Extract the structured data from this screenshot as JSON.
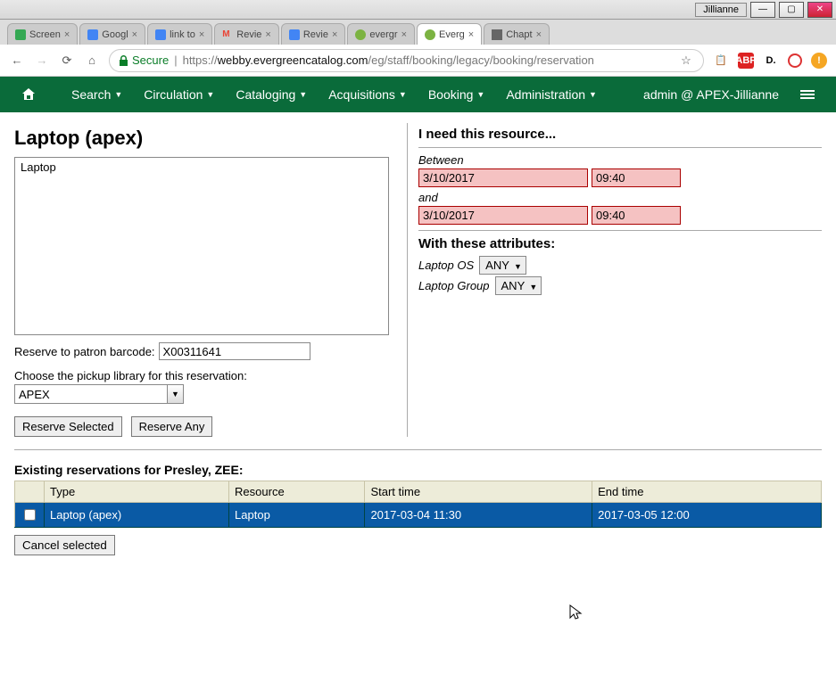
{
  "window": {
    "user": "Jillianne"
  },
  "tabs": [
    {
      "label": "Screen",
      "icon_color": "#34a853"
    },
    {
      "label": "Googl",
      "icon_color": "#4285f4"
    },
    {
      "label": "link to",
      "icon_color": "#4285f4"
    },
    {
      "label": "Revie",
      "icon_color": "#ea4335"
    },
    {
      "label": "Revie",
      "icon_color": "#4285f4"
    },
    {
      "label": "evergr",
      "icon_color": "#7cb342"
    },
    {
      "label": "Everg",
      "icon_color": "#7cb342",
      "active": true
    },
    {
      "label": "Chapt",
      "icon_color": "#555"
    }
  ],
  "addressbar": {
    "secure_label": "Secure",
    "url_prefix": "https://",
    "url_host": "webby.evergreencatalog.com",
    "url_path": "/eg/staff/booking/legacy/booking/reservation"
  },
  "nav": {
    "items": [
      "Search",
      "Circulation",
      "Cataloging",
      "Acquisitions",
      "Booking",
      "Administration"
    ],
    "user_label": "admin @ APEX-Jillianne"
  },
  "resource": {
    "title": "Laptop (apex)",
    "list": [
      "Laptop"
    ],
    "reserve_barcode_label": "Reserve to patron barcode:",
    "reserve_barcode_value": "X00311641",
    "pickup_label": "Choose the pickup library for this reservation:",
    "pickup_value": "APEX",
    "reserve_selected_label": "Reserve Selected",
    "reserve_any_label": "Reserve Any"
  },
  "need": {
    "heading": "I need this resource...",
    "between_label": "Between",
    "and_label": "and",
    "date1": "3/10/2017",
    "time1": "09:40",
    "date2": "3/10/2017",
    "time2": "09:40",
    "attrs_heading": "With these attributes:",
    "attrs": [
      {
        "label": "Laptop OS",
        "value": "ANY"
      },
      {
        "label": "Laptop Group",
        "value": "ANY"
      }
    ]
  },
  "reservations": {
    "heading": "Existing reservations for Presley, ZEE:",
    "columns": [
      "Type",
      "Resource",
      "Start time",
      "End time"
    ],
    "rows": [
      {
        "type": "Laptop (apex)",
        "resource": "Laptop",
        "start": "2017-03-04 11:30",
        "end": "2017-03-05 12:00"
      }
    ],
    "cancel_label": "Cancel selected"
  }
}
